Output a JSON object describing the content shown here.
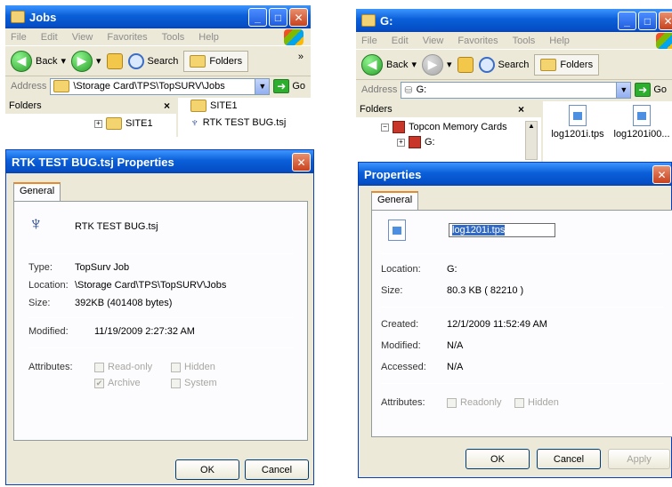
{
  "left_window": {
    "title": "Jobs",
    "menu": [
      "File",
      "Edit",
      "View",
      "Favorites",
      "Tools",
      "Help"
    ],
    "toolbar": {
      "back": "Back",
      "search": "Search",
      "folders": "Folders",
      "overflow": "»"
    },
    "address": {
      "label": "Address",
      "value": "\\Storage Card\\TPS\\TopSURV\\Jobs",
      "go": "Go"
    },
    "folders_pane": {
      "header": "Folders",
      "close": "×",
      "tree_item": "SITE1"
    },
    "file_list": [
      "SITE1",
      "RTK TEST BUG.tsj"
    ]
  },
  "left_dialog": {
    "title": "RTK TEST BUG.tsj Properties",
    "tab": "General",
    "filename": "RTK TEST BUG.tsj",
    "rows": [
      {
        "label": "Type:",
        "value": "TopSurv Job"
      },
      {
        "label": "Location:",
        "value": "\\Storage Card\\TPS\\TopSURV\\Jobs"
      },
      {
        "label": "Size:",
        "value": "392KB (401408 bytes)"
      }
    ],
    "modified": {
      "label": "Modified:",
      "value": "11/19/2009  2:27:32 AM"
    },
    "attributes": {
      "label": "Attributes:",
      "items": [
        {
          "name": "Read-only",
          "checked": false
        },
        {
          "name": "Hidden",
          "checked": false
        },
        {
          "name": "Archive",
          "checked": true
        },
        {
          "name": "System",
          "checked": false
        }
      ]
    },
    "buttons": {
      "ok": "OK",
      "cancel": "Cancel"
    }
  },
  "right_window": {
    "title": "G:",
    "menu": [
      "File",
      "Edit",
      "View",
      "Favorites",
      "Tools",
      "Help"
    ],
    "toolbar": {
      "back": "Back",
      "search": "Search",
      "folders": "Folders"
    },
    "address": {
      "label": "Address",
      "value": "G:",
      "go": "Go"
    },
    "folders_pane": {
      "header": "Folders",
      "close": "×",
      "tree_root": "Topcon Memory Cards",
      "tree_child": "G:"
    },
    "files": [
      "log1201i.tps",
      "log1201i00..."
    ]
  },
  "right_dialog": {
    "title": "Properties",
    "tab": "General",
    "filename": "log1201i.tps",
    "rows": [
      {
        "label": "Location:",
        "value": "G:"
      },
      {
        "label": "Size:",
        "value": "80.3 KB ( 82210 )"
      }
    ],
    "dates": [
      {
        "label": "Created:",
        "value": "12/1/2009 11:52:49 AM"
      },
      {
        "label": "Modified:",
        "value": "N/A"
      },
      {
        "label": "Accessed:",
        "value": "N/A"
      }
    ],
    "attributes": {
      "label": "Attributes:",
      "items": [
        {
          "name": "Readonly",
          "checked": false
        },
        {
          "name": "Hidden",
          "checked": false
        }
      ]
    },
    "buttons": {
      "ok": "OK",
      "cancel": "Cancel",
      "apply": "Apply"
    }
  }
}
